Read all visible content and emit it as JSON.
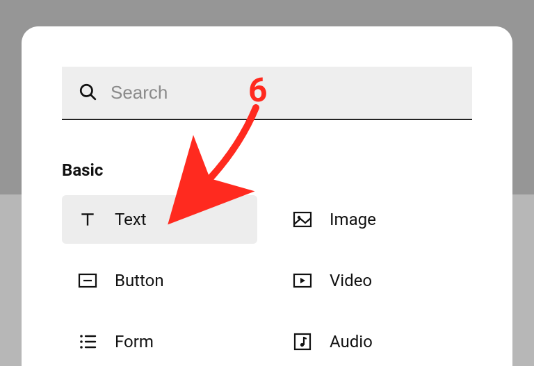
{
  "search": {
    "placeholder": "Search",
    "value": ""
  },
  "section": {
    "title": "Basic"
  },
  "items": [
    {
      "label": "Text",
      "icon": "text-icon",
      "selected": true
    },
    {
      "label": "Image",
      "icon": "image-icon",
      "selected": false
    },
    {
      "label": "Button",
      "icon": "button-icon",
      "selected": false
    },
    {
      "label": "Video",
      "icon": "video-icon",
      "selected": false
    },
    {
      "label": "Form",
      "icon": "form-icon",
      "selected": false
    },
    {
      "label": "Audio",
      "icon": "audio-icon",
      "selected": false
    }
  ],
  "annotation": {
    "number": "6",
    "color": "#ff2a1f"
  }
}
